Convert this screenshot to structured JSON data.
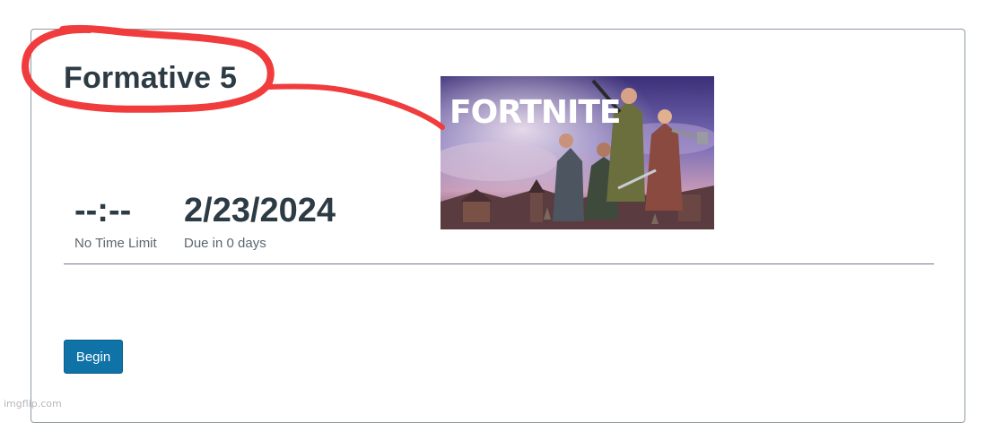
{
  "quiz": {
    "title": "Formative 5",
    "time": {
      "value": "--:--",
      "label": "No Time Limit"
    },
    "due": {
      "value": "2/23/2024",
      "label": "Due in 0 days"
    },
    "begin_label": "Begin"
  },
  "image": {
    "logo_text": "FORTNITE"
  },
  "watermark": "imgflip.com",
  "colors": {
    "annotation_red": "#f03c3c",
    "button_blue": "#0f73a8",
    "text_dark": "#2d3b45"
  }
}
